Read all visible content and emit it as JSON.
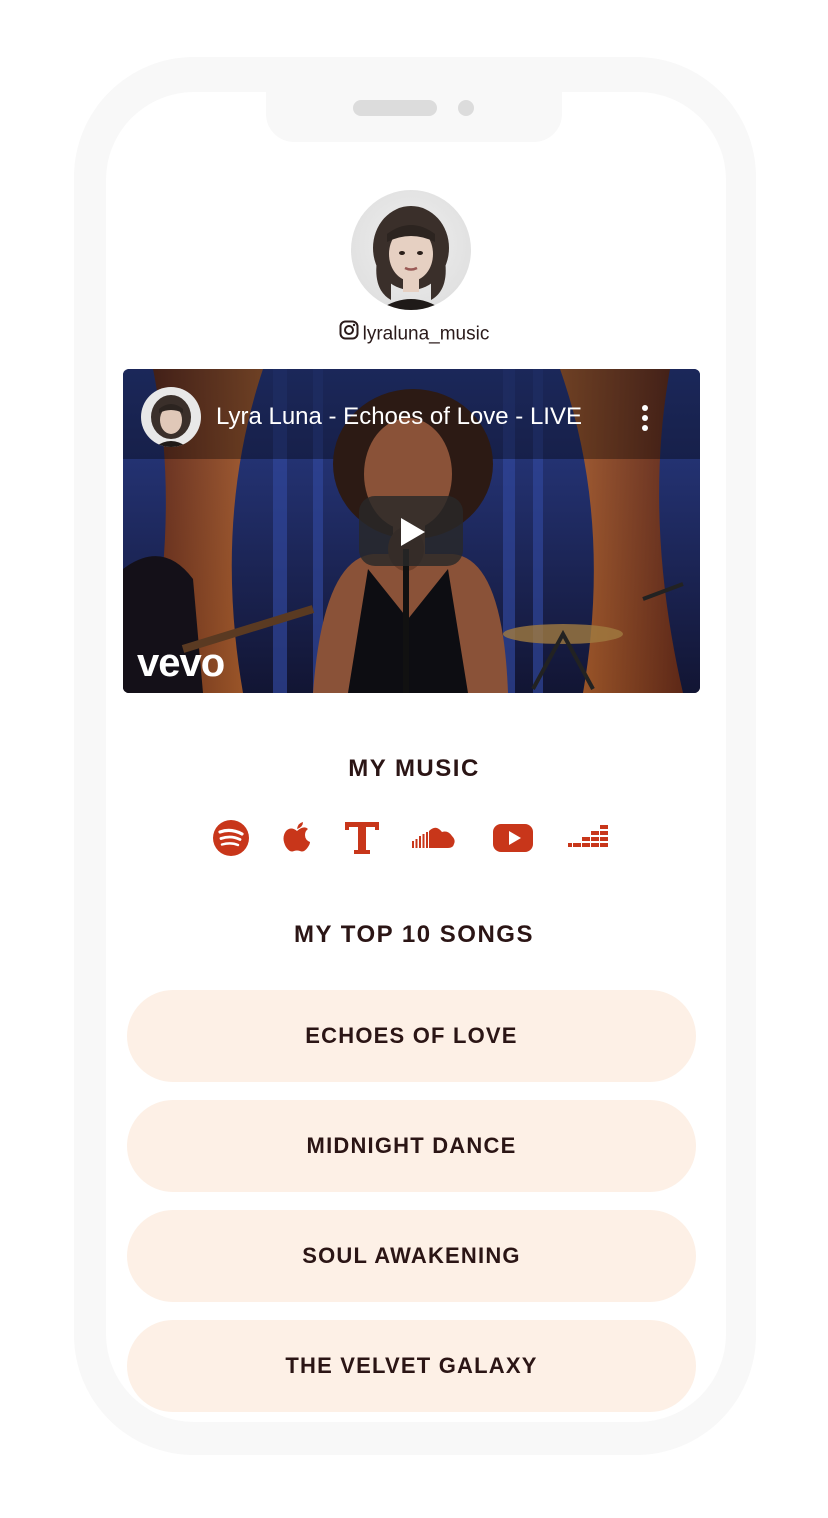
{
  "profile": {
    "handle": "lyraluna_music"
  },
  "video": {
    "title": "Lyra Luna - Echoes of Love - LIVE",
    "logo_text": "vevo"
  },
  "music": {
    "heading": "MY MUSIC",
    "icons": [
      "spotify-icon",
      "apple-music-icon",
      "tidal-icon",
      "soundcloud-icon",
      "youtube-icon",
      "deezer-icon"
    ],
    "accent_color": "#c8361a"
  },
  "top_songs": {
    "heading": "MY TOP 10 SONGS",
    "songs": [
      {
        "label": "ECHOES OF LOVE"
      },
      {
        "label": "MIDNIGHT DANCE"
      },
      {
        "label": "SOUL AWAKENING"
      },
      {
        "label": "THE VELVET GALAXY"
      }
    ],
    "button_color": "#fdf0e6"
  }
}
